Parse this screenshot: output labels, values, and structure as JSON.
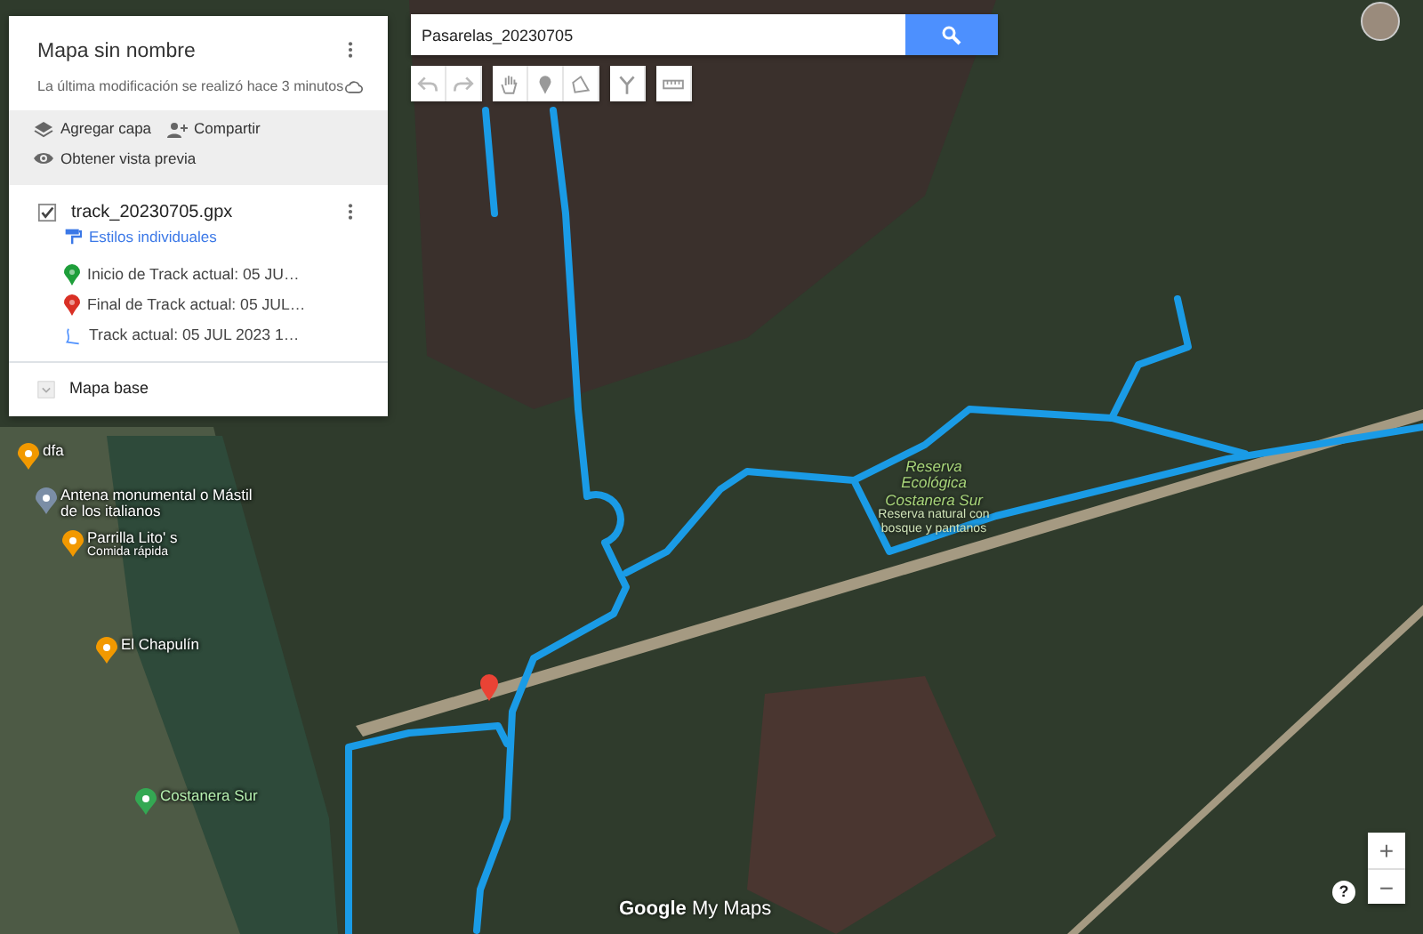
{
  "panel": {
    "title": "Mapa sin nombre",
    "subtitle": "La última modificación se realizó hace 3 minutos"
  },
  "panel_actions": [
    {
      "kind": "layers",
      "label": "Agregar capa"
    },
    {
      "kind": "share",
      "label": "Compartir"
    },
    {
      "kind": "preview",
      "label": "Obtener vista previa"
    }
  ],
  "layer": {
    "name": "track_20230705.gpx",
    "checked": true,
    "style_link": "Estilos individuales",
    "items": [
      {
        "kind": "pin",
        "color": "#1e9e3a",
        "label": "Inicio de Track actual: 05 JU…"
      },
      {
        "kind": "pin",
        "color": "#d93025",
        "label": "Final de Track actual: 05 JUL…"
      },
      {
        "kind": "line",
        "label": "Track actual: 05 JUL 2023 1…"
      }
    ]
  },
  "base_layer": {
    "label": "Mapa base"
  },
  "search": {
    "value": "Pasarelas_20230705"
  },
  "toolbar": [
    {
      "kind": "undo"
    },
    {
      "kind": "redo"
    },
    {
      "kind": "hand"
    },
    {
      "kind": "pin"
    },
    {
      "kind": "polygon"
    },
    {
      "kind": "route"
    },
    {
      "kind": "ruler"
    }
  ],
  "map_labels": [
    {
      "kind": "food",
      "text": "dfa"
    },
    {
      "kind": "place",
      "text": "Antena monumental o Mástil de los italianos"
    },
    {
      "kind": "food",
      "text": "Parrilla Lito' s",
      "subtitle": "Comida rápida"
    },
    {
      "kind": "food",
      "text": "El Chapulín"
    },
    {
      "kind": "park",
      "text": "Costanera Sur"
    },
    {
      "kind": "area",
      "text": "Reserva Ecológica Costanera Sur",
      "subtitle": "Reserva natural con bosque y pantanos"
    }
  ],
  "attribution": {
    "brand": "Google",
    "product": "My Maps"
  },
  "zoom_controls": [
    "+",
    "−"
  ],
  "help": "?"
}
